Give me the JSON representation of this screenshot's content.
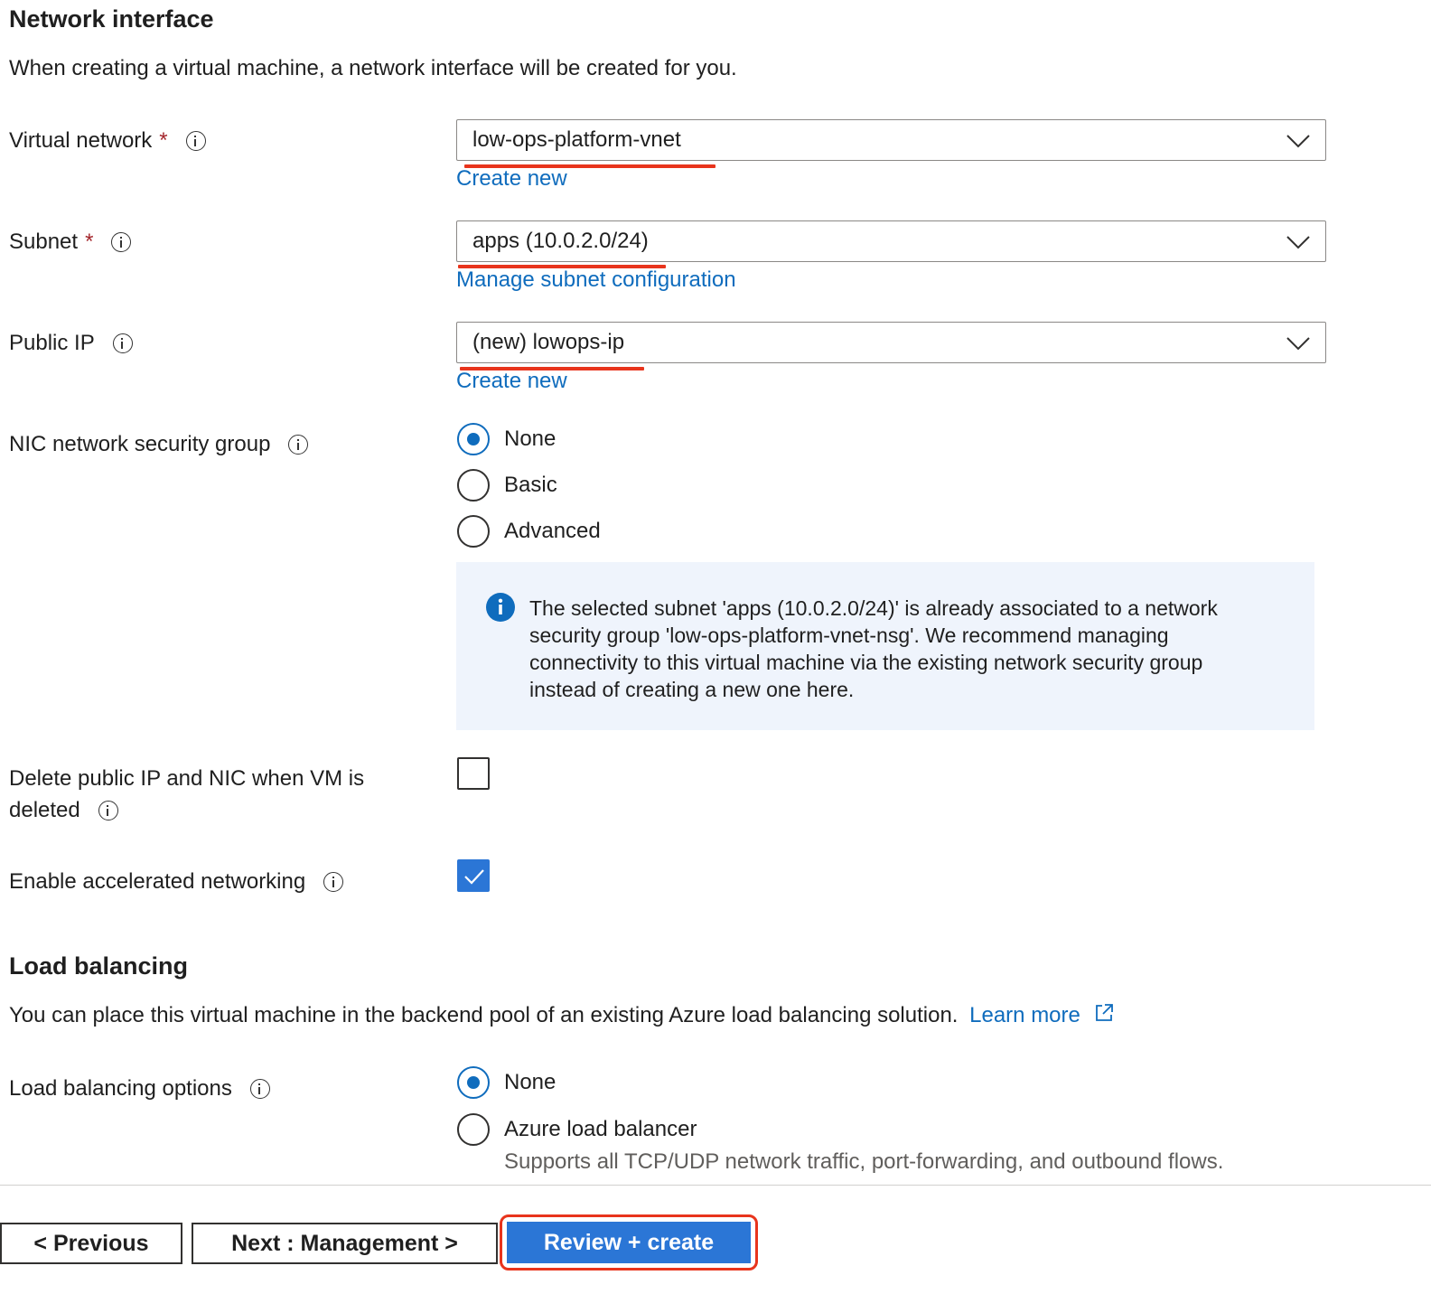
{
  "network_interface": {
    "title": "Network interface",
    "description": "When creating a virtual machine, a network interface will be created for you.",
    "virtual_network": {
      "label": "Virtual network",
      "required_mark": "*",
      "value": "low-ops-platform-vnet",
      "link": "Create new"
    },
    "subnet": {
      "label": "Subnet",
      "required_mark": "*",
      "value": "apps (10.0.2.0/24)",
      "link": "Manage subnet configuration"
    },
    "public_ip": {
      "label": "Public IP",
      "value": "(new) lowops-ip",
      "link": "Create new"
    },
    "nic_nsg": {
      "label": "NIC network security group",
      "options": [
        "None",
        "Basic",
        "Advanced"
      ],
      "selected": "None"
    },
    "info_message": "The selected subnet 'apps (10.0.2.0/24)' is already associated to a network security group 'low-ops-platform-vnet-nsg'. We recommend managing connectivity to this virtual machine via the existing network security group instead of creating a new one here.",
    "delete_public_ip": {
      "label_line1": "Delete public IP and NIC when VM is",
      "label_line2": "deleted",
      "checked": false
    },
    "accelerated_networking": {
      "label": "Enable accelerated networking",
      "checked": true
    }
  },
  "load_balancing": {
    "title": "Load balancing",
    "description": "You can place this virtual machine in the backend pool of an existing Azure load balancing solution.",
    "learn_more": "Learn more",
    "options_label": "Load balancing options",
    "options": [
      "None",
      "Azure load balancer"
    ],
    "selected": "None",
    "azure_lb_description": "Supports all TCP/UDP network traffic, port-forwarding, and outbound flows."
  },
  "footer": {
    "previous": "< Previous",
    "next": "Next : Management >",
    "review": "Review + create"
  },
  "colors": {
    "accent": "#0f6cbd",
    "primary_button": "#2b76d6",
    "highlight": "#e8341c",
    "info_background": "#eff4fc"
  }
}
